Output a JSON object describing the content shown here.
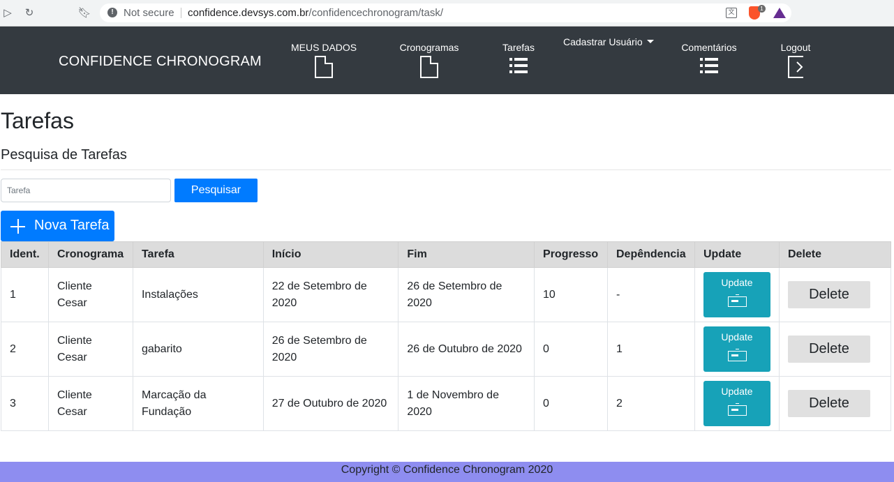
{
  "browser": {
    "security_label": "Not secure",
    "url_host": "confidence.devsys.com.br",
    "url_path": "/confidencechronogram/task/",
    "extension_badge": "1"
  },
  "navbar": {
    "brand": "CONFIDENCE CHRONOGRAM",
    "items": [
      {
        "label": "MEUS DADOS",
        "icon": "file-icon"
      },
      {
        "label": "Cronogramas",
        "icon": "file-icon"
      },
      {
        "label": "Tarefas",
        "icon": "list-icon"
      },
      {
        "label": "Cadastrar Usuário",
        "icon": "dropdown-caret"
      },
      {
        "label": "Comentários",
        "icon": "list-icon"
      },
      {
        "label": "Logout",
        "icon": "logout-icon"
      }
    ]
  },
  "page": {
    "title": "Tarefas",
    "section_title": "Pesquisa de Tarefas"
  },
  "search": {
    "placeholder": "Tarefa",
    "value": "",
    "button_label": "Pesquisar"
  },
  "new_task_label": "Nova Tarefa",
  "table": {
    "headers": [
      "Ident.",
      "Cronograma",
      "Tarefa",
      "Início",
      "Fim",
      "Progresso",
      "Depêndencia",
      "Update",
      "Delete"
    ],
    "rows": [
      {
        "id": "1",
        "cronograma": "Cliente Cesar",
        "tarefa": "Instalações",
        "inicio": "22 de Setembro de 2020",
        "fim": "26 de Setembro de 2020",
        "progresso": "10",
        "dependencia": "-",
        "update": "Update",
        "delete": "Delete"
      },
      {
        "id": "2",
        "cronograma": "Cliente Cesar",
        "tarefa": "gabarito",
        "inicio": "26 de Setembro de 2020",
        "fim": "26 de Outubro de 2020",
        "progresso": "0",
        "dependencia": "1",
        "update": "Update",
        "delete": "Delete"
      },
      {
        "id": "3",
        "cronograma": "Cliente Cesar",
        "tarefa": "Marcação da Fundação",
        "inicio": "27 de Outubro de 2020",
        "fim": "1 de Novembro de 2020",
        "progresso": "0",
        "dependencia": "2",
        "update": "Update",
        "delete": "Delete"
      }
    ]
  },
  "footer": {
    "text": "Copyright © Confidence Chronogram 2020"
  },
  "colors": {
    "navbar_bg": "#343a40",
    "primary": "#007bff",
    "info": "#17a2b8",
    "footer_bg": "#8e8df0"
  }
}
